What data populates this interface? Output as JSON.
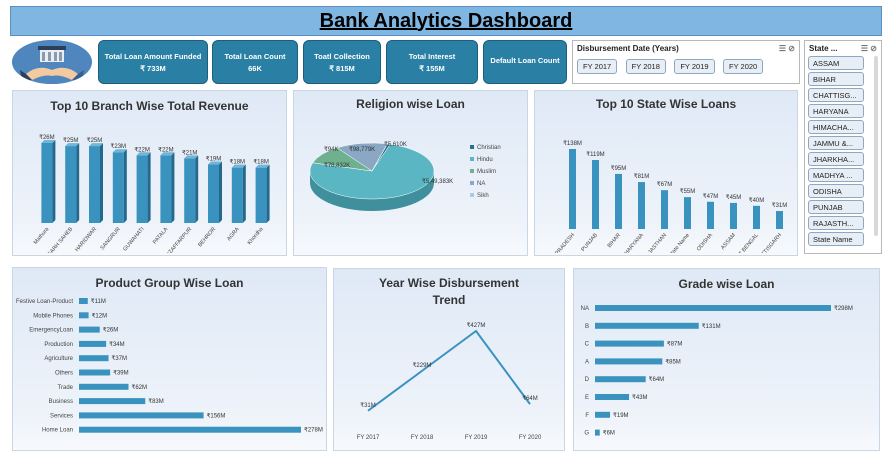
{
  "header": {
    "title": "Bank Analytics Dashboard"
  },
  "kpis": [
    {
      "label": "Total Loan Amount Funded",
      "value": "₹ 733M"
    },
    {
      "label": "Total Loan Count",
      "value": "66K"
    },
    {
      "label": "Toatl Collection",
      "value": "₹ 815M"
    },
    {
      "label": "Total Interest",
      "value": "₹ 155M"
    },
    {
      "label": "Default Loan Count",
      "value": ""
    }
  ],
  "year_slicer": {
    "title": "Disbursement Date (Years)",
    "options": [
      "FY 2017",
      "FY 2018",
      "FY 2019",
      "FY 2020"
    ]
  },
  "state_slicer": {
    "title": "State ...",
    "options": [
      "ASSAM",
      "BIHAR",
      "CHATTISG...",
      "HARYANA",
      "HIMACHA...",
      "JAMMU &...",
      "JHARKHA...",
      "MADHYA ...",
      "ODISHA",
      "PUNJAB",
      "RAJASTH...",
      "State Name"
    ]
  },
  "colors": {
    "accent": "#2a7fa4",
    "bar": "#3a93bf",
    "title_bg": "#7fb7e2"
  },
  "chart_data": [
    {
      "type": "bar",
      "title": "Top 10 Branch Wise Total Revenue",
      "categories": [
        "Mathura",
        "FATEHGARH SAHEB",
        "HARIDWAR",
        "SANGRUR",
        "GUWAHATI",
        "PATALA",
        "MUZAFFARPUR",
        "BEHROR",
        "AGRA",
        "Khordha"
      ],
      "values": [
        26,
        25,
        25,
        23,
        22,
        22,
        21,
        19,
        18,
        18
      ],
      "data_labels": [
        "₹26M",
        "₹25M",
        "₹25M",
        "₹23M",
        "₹22M",
        "₹22M",
        "₹21M",
        "₹19M",
        "₹18M",
        "₹18M"
      ]
    },
    {
      "type": "pie",
      "title": "Religion wise Loan",
      "categories": [
        "Christian",
        "Hindu",
        "Muslim",
        "NA",
        "Sikh"
      ],
      "values": [
        5610,
        549383,
        78832,
        98779,
        94
      ],
      "data_labels": [
        "₹5,610K",
        "₹5,49,383K",
        "₹78,832K",
        "₹98,779K",
        "₹94K"
      ],
      "colors": [
        "#2d6f8f",
        "#5bb6c4",
        "#6fb08e",
        "#8aa7c4",
        "#b0c8e0"
      ]
    },
    {
      "type": "bar",
      "title": "Top 10 State Wise Loans",
      "categories": [
        "UTTAR PRADESH",
        "PUNJAB",
        "BIHAR",
        "HARYANA",
        "RAJASTHAN",
        "State Name",
        "ODISHA",
        "ASSAM",
        "WEST BENGAL",
        "CHATTISGARH"
      ],
      "values": [
        138,
        119,
        95,
        81,
        67,
        55,
        47,
        45,
        40,
        31
      ],
      "data_labels": [
        "₹138M",
        "₹119M",
        "₹95M",
        "₹81M",
        "₹67M",
        "₹55M",
        "₹47M",
        "₹45M",
        "₹40M",
        "₹31M"
      ]
    },
    {
      "type": "bar",
      "title": "Product Group Wise Loan",
      "categories": [
        "Festive Loan-Product",
        "Mobile Phones",
        "EmergencyLoan",
        "Production",
        "Agriculture",
        "Others",
        "Trade",
        "Business",
        "Services",
        "Home Loan"
      ],
      "values": [
        11,
        12,
        26,
        34,
        37,
        39,
        62,
        83,
        156,
        278
      ],
      "data_labels": [
        "₹11M",
        "₹12M",
        "₹26M",
        "₹34M",
        "₹37M",
        "₹39M",
        "₹62M",
        "₹83M",
        "₹156M",
        "₹278M"
      ]
    },
    {
      "type": "line",
      "title": "Year Wise Disbursement Trend",
      "categories": [
        "FY 2017",
        "FY 2018",
        "FY 2019",
        "FY 2020"
      ],
      "values": [
        31,
        229,
        427,
        64
      ],
      "data_labels": [
        "₹31M",
        "₹229M",
        "₹427M",
        "₹64M"
      ]
    },
    {
      "type": "bar",
      "title": "Grade wise Loan",
      "categories": [
        "NA",
        "B",
        "C",
        "A",
        "D",
        "E",
        "F",
        "G"
      ],
      "values": [
        298,
        131,
        87,
        85,
        64,
        43,
        19,
        6
      ],
      "data_labels": [
        "₹298M",
        "₹131M",
        "₹87M",
        "₹85M",
        "₹64M",
        "₹43M",
        "₹19M",
        "₹6M"
      ]
    }
  ]
}
